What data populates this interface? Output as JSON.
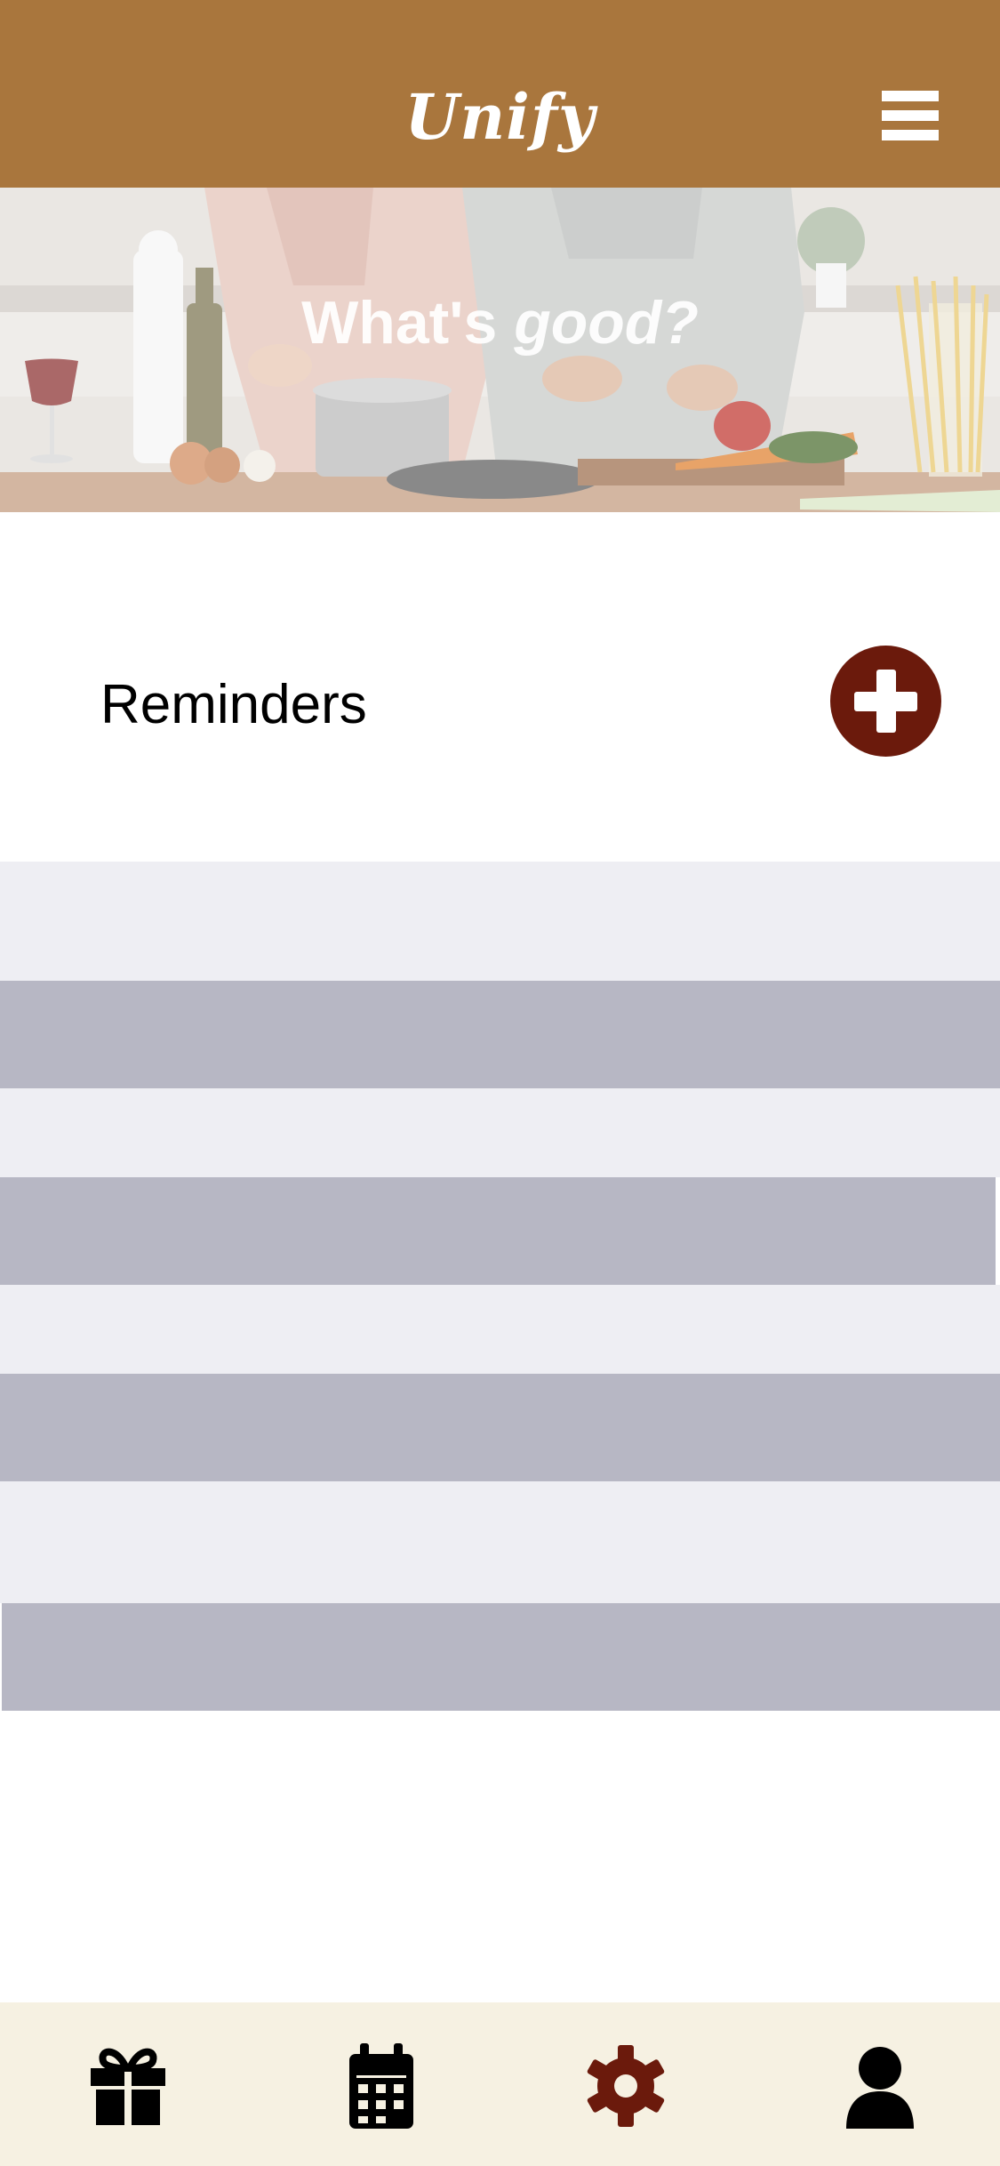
{
  "header": {
    "title": "Unify",
    "menu_icon": "hamburger-menu-icon"
  },
  "hero": {
    "title_plain": "What's ",
    "title_italic": "good?"
  },
  "reminders": {
    "title": "Reminders",
    "add_icon": "plus-circle-icon",
    "rows": [
      {
        "text": ""
      },
      {
        "text": ""
      },
      {
        "text": ""
      },
      {
        "text": ""
      },
      {
        "text": ""
      },
      {
        "text": ""
      },
      {
        "text": ""
      },
      {
        "text": ""
      }
    ]
  },
  "bottom_nav": {
    "items": [
      {
        "icon": "gift-icon",
        "active": false
      },
      {
        "icon": "calendar-icon",
        "active": false
      },
      {
        "icon": "gear-icon",
        "active": true
      },
      {
        "icon": "user-icon",
        "active": false
      }
    ]
  },
  "colors": {
    "header_bg": "#a9763d",
    "accent": "#6b1a0c",
    "row_light": "#eeeef3",
    "row_dark": "#b7b7c4",
    "nav_bg": "#f6f1e2"
  }
}
